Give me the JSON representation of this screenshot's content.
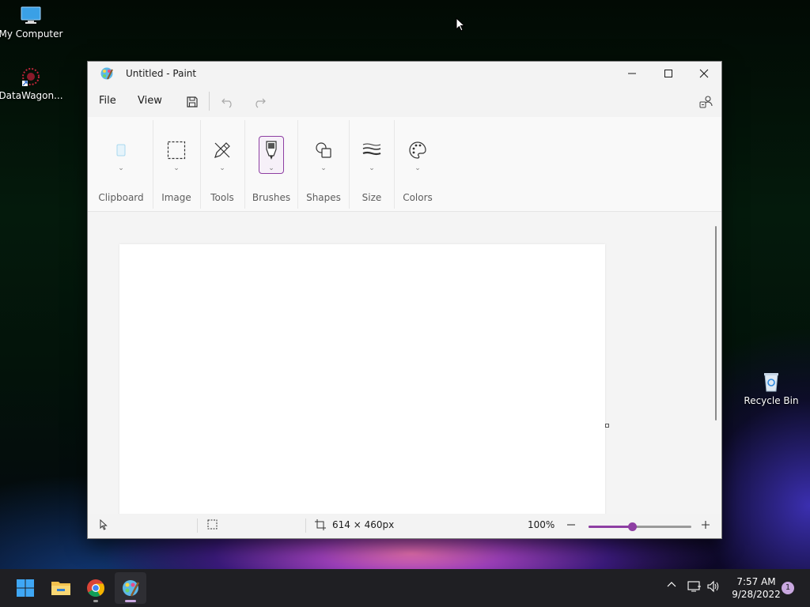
{
  "desktop": {
    "icons": [
      {
        "label": "My Computer"
      },
      {
        "label": "DataWagon..."
      },
      {
        "label": "Recycle Bin"
      }
    ]
  },
  "window": {
    "title": "Untitled - Paint",
    "menu": {
      "file": "File",
      "view": "View"
    },
    "ribbon": {
      "groups": [
        {
          "label": "Clipboard",
          "icon": "clipboard-icon"
        },
        {
          "label": "Image",
          "icon": "selection-icon"
        },
        {
          "label": "Tools",
          "icon": "pencil-icon"
        },
        {
          "label": "Brushes",
          "icon": "brush-icon"
        },
        {
          "label": "Shapes",
          "icon": "shapes-icon"
        },
        {
          "label": "Size",
          "icon": "line-size-icon"
        },
        {
          "label": "Colors",
          "icon": "palette-icon"
        }
      ]
    },
    "status": {
      "canvas_size": "614 × 460px",
      "zoom": "100%",
      "zoom_level": 0.42
    }
  },
  "taskbar": {
    "time": "7:57 AM",
    "date": "9/28/2022",
    "notification_count": "1"
  },
  "colors": {
    "accent": "#8e3fa3",
    "taskbar": "#1f1f23"
  }
}
